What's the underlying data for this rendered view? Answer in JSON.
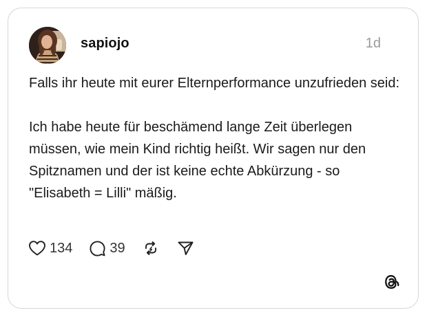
{
  "post": {
    "username": "sapiojo",
    "timestamp": "1d",
    "paragraph_1": "Falls ihr heute mit eurer Elternperformance unzufrieden seid:",
    "paragraph_2": "Ich habe heute für beschämend lange Zeit überlegen müssen, wie mein Kind richtig heißt. Wir sagen nur den Spitznamen und der ist keine echte Abkürzung - so \"Elisabeth = Lilli\" mäßig.",
    "likes": "134",
    "replies": "39"
  },
  "icons": {
    "like": "heart-icon",
    "reply": "speech-bubble-icon",
    "repost": "repost-arrows-icon",
    "share": "paper-plane-icon",
    "brand": "threads-logo-icon"
  },
  "colors": {
    "text": "#1a1a1a",
    "muted": "#999999",
    "border": "#d6d6d6",
    "background": "#ffffff"
  }
}
